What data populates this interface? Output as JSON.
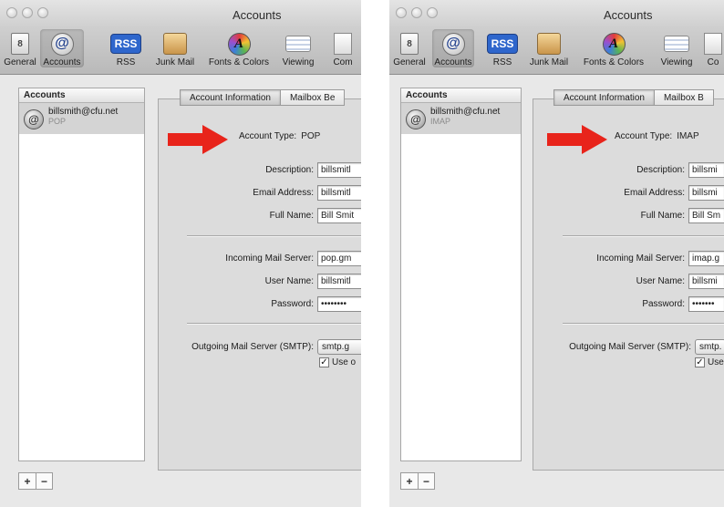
{
  "windows": [
    {
      "title": "Accounts",
      "toolbar": [
        "General",
        "Accounts",
        "RSS",
        "Junk Mail",
        "Fonts & Colors",
        "Viewing",
        "Com"
      ],
      "sidebar": {
        "header": "Accounts",
        "email": "billsmith@cfu.net",
        "type": "POP"
      },
      "tabs": [
        "Account Information",
        "Mailbox Be"
      ],
      "form": {
        "account_type_label": "Account Type:",
        "account_type_value": "POP",
        "description_label": "Description:",
        "description_value": "billsmitl",
        "email_label": "Email Address:",
        "email_value": "billsmitl",
        "fullname_label": "Full Name:",
        "fullname_value": "Bill Smit",
        "incoming_label": "Incoming Mail Server:",
        "incoming_value": "pop.gm",
        "username_label": "User Name:",
        "username_value": "billsmitl",
        "password_label": "Password:",
        "password_value": "••••••••",
        "smtp_label": "Outgoing Mail Server (SMTP):",
        "smtp_value": "smtp.g",
        "use_label": "Use o"
      },
      "add_label": "+",
      "remove_label": "−"
    },
    {
      "title": "Accounts",
      "toolbar": [
        "General",
        "Accounts",
        "RSS",
        "Junk Mail",
        "Fonts & Colors",
        "Viewing",
        "Co"
      ],
      "sidebar": {
        "header": "Accounts",
        "email": "billsmith@cfu.net",
        "type": "IMAP"
      },
      "tabs": [
        "Account Information",
        "Mailbox B"
      ],
      "form": {
        "account_type_label": "Account Type:",
        "account_type_value": "IMAP",
        "description_label": "Description:",
        "description_value": "billsmi",
        "email_label": "Email Address:",
        "email_value": "billsmi",
        "fullname_label": "Full Name:",
        "fullname_value": "Bill Sm",
        "incoming_label": "Incoming Mail Server:",
        "incoming_value": "imap.g",
        "username_label": "User Name:",
        "username_value": "billsmi",
        "password_label": "Password:",
        "password_value": "•••••••",
        "smtp_label": "Outgoing Mail Server (SMTP):",
        "smtp_value": "smtp.",
        "use_label": "Use"
      },
      "add_label": "+",
      "remove_label": "−"
    }
  ],
  "colors": {
    "arrow": "#e8241b",
    "selected_row": "#d4d4d4",
    "panel": "#dcdcdc"
  },
  "icons": [
    "general-icon",
    "at-icon",
    "rss-icon",
    "junk-mail-icon",
    "fonts-colors-icon",
    "viewing-icon",
    "composing-icon",
    "account-at-icon",
    "red-arrow-icon"
  ]
}
